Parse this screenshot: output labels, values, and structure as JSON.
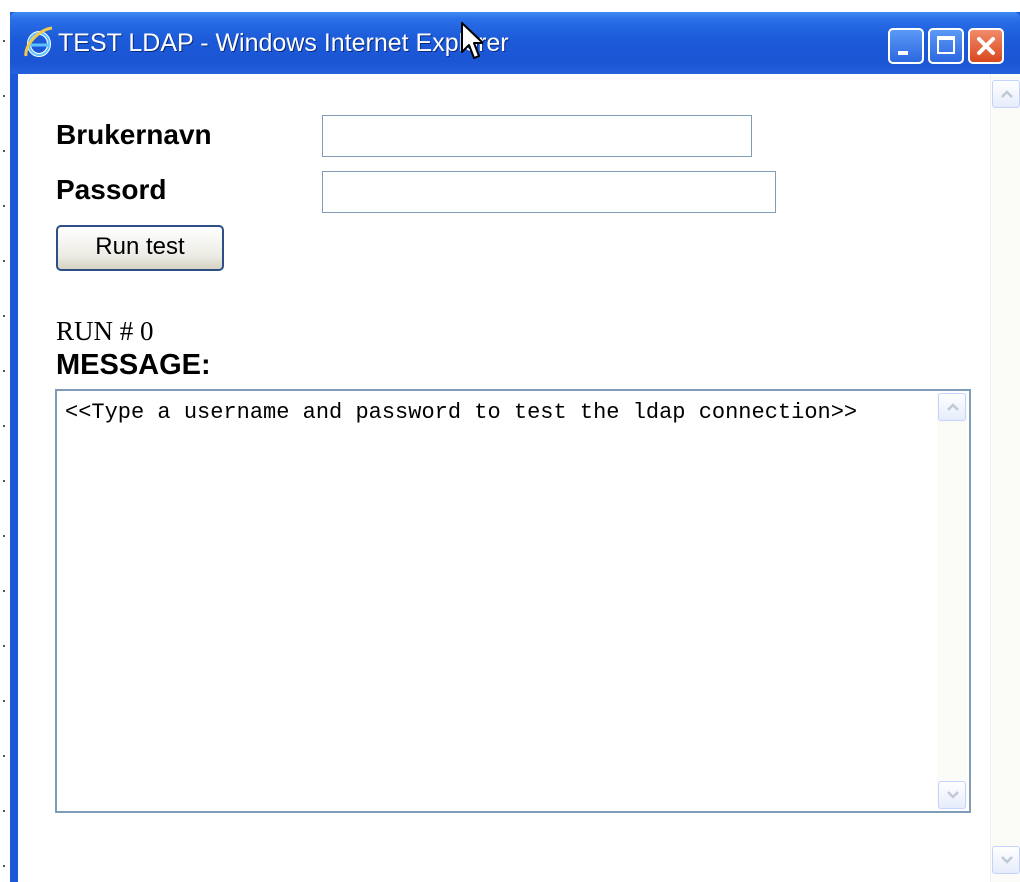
{
  "window": {
    "title": "TEST LDAP - Windows Internet Explorer",
    "icon": "ie-logo-icon",
    "controls": [
      "minimize-icon",
      "maximize-icon",
      "close-icon"
    ]
  },
  "form": {
    "username_label": "Brukernavn",
    "username_value": "",
    "password_label": "Passord",
    "password_value": "",
    "run_button_label": "Run test"
  },
  "status": {
    "run_label": "RUN #",
    "run_number": "0"
  },
  "message": {
    "title": "MESSAGE:",
    "text": "<<Type a username and password to test the ldap connection>>"
  },
  "colors": {
    "titlebar": "#1b55d4",
    "close_button": "#d8481f",
    "input_border": "#7f9db9"
  }
}
